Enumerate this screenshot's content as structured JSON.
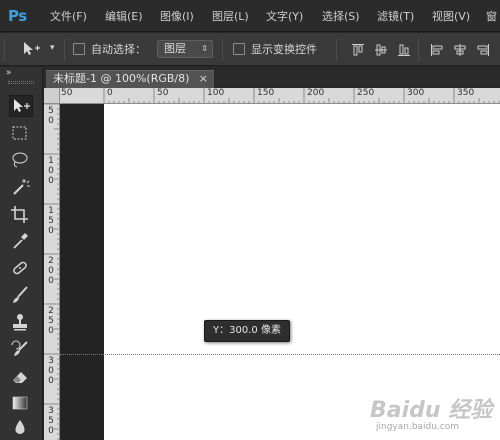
{
  "app": {
    "logo_text": "Ps"
  },
  "menu": [
    {
      "label": "文件(F)"
    },
    {
      "label": "编辑(E)"
    },
    {
      "label": "图像(I)"
    },
    {
      "label": "图层(L)"
    },
    {
      "label": "文字(Y)"
    },
    {
      "label": "选择(S)"
    },
    {
      "label": "滤镜(T)"
    },
    {
      "label": "视图(V)"
    },
    {
      "label": "窗"
    }
  ],
  "options_bar": {
    "auto_select_label": "自动选择：",
    "auto_select_checked": false,
    "auto_select_target": "图层",
    "show_transform_label": "显示变换控件",
    "show_transform_checked": false
  },
  "panel_toggle": "»",
  "tools_grip": "»",
  "document": {
    "tab_title": "未标题-1 @ 100%(RGB/8)",
    "close_glyph": "×"
  },
  "rulers": {
    "horizontal": [
      {
        "label": "50"
      },
      {
        "label": "0"
      },
      {
        "label": "50"
      },
      {
        "label": "100"
      },
      {
        "label": "150"
      },
      {
        "label": "200"
      },
      {
        "label": "250"
      },
      {
        "label": "300"
      },
      {
        "label": "350"
      }
    ],
    "vertical": [
      {
        "label": "50"
      },
      {
        "label": "100"
      },
      {
        "label": "150"
      },
      {
        "label": "200"
      },
      {
        "label": "250"
      },
      {
        "label": "300"
      },
      {
        "label": "350"
      }
    ]
  },
  "tooltip": {
    "text": "Y：300.0 像素"
  },
  "watermark": {
    "logo": "Baidu 经验",
    "url": "jingyan.baidu.com"
  },
  "colors": {
    "accent": "#3aa0e6",
    "canvas": "#ffffff",
    "pasteboard": "#232323",
    "panel": "#323232"
  },
  "tools": [
    {
      "icon": "move-tool-icon"
    },
    {
      "icon": "rectangular-marquee-icon"
    },
    {
      "icon": "lasso-icon"
    },
    {
      "icon": "magic-wand-icon"
    },
    {
      "icon": "crop-icon"
    },
    {
      "icon": "eyedropper-icon"
    },
    {
      "icon": "healing-brush-icon"
    },
    {
      "icon": "brush-icon"
    },
    {
      "icon": "clone-stamp-icon"
    },
    {
      "icon": "history-brush-icon"
    },
    {
      "icon": "eraser-icon"
    },
    {
      "icon": "gradient-icon"
    },
    {
      "icon": "blur-icon"
    }
  ]
}
